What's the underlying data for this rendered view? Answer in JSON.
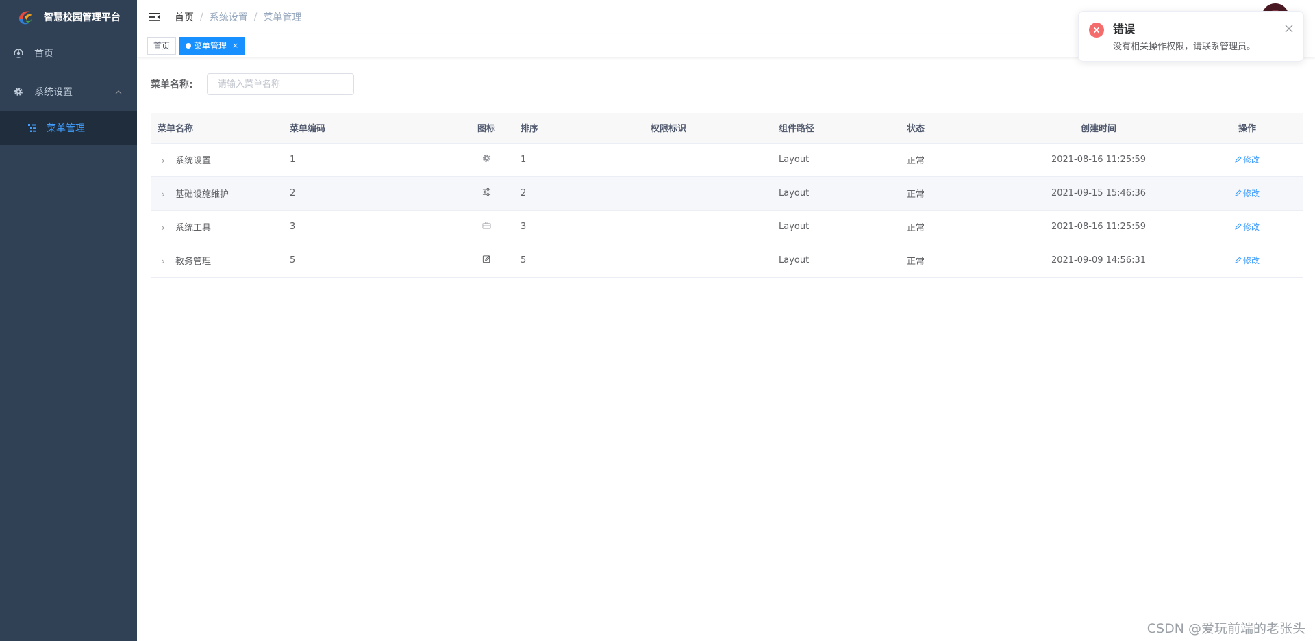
{
  "sidebar": {
    "logo_title": "智慧校园管理平台",
    "items": [
      {
        "label": "首页",
        "icon": "dashboard-icon"
      },
      {
        "label": "系统设置",
        "icon": "gear-icon"
      },
      {
        "label": "菜单管理",
        "icon": "tree-table-icon"
      }
    ]
  },
  "navbar": {
    "breadcrumb": [
      "首页",
      "系统设置",
      "菜单管理"
    ],
    "separator": "/"
  },
  "tags": [
    {
      "label": "首页",
      "active": false
    },
    {
      "label": "菜单管理",
      "active": true,
      "close": "×"
    }
  ],
  "search": {
    "label": "菜单名称:",
    "placeholder": "请输入菜单名称"
  },
  "table": {
    "headers": [
      "菜单名称",
      "菜单编码",
      "图标",
      "排序",
      "权限标识",
      "组件路径",
      "状态",
      "创建时间",
      "操作"
    ],
    "rows": [
      {
        "name": "系统设置",
        "code": "1",
        "icon": "gear-icon",
        "order": "1",
        "perm": "",
        "component": "Layout",
        "status": "正常",
        "created": "2021-08-16 11:25:59",
        "action": "修改"
      },
      {
        "name": "基础设施维护",
        "code": "2",
        "icon": "sliders-icon",
        "order": "2",
        "perm": "",
        "component": "Layout",
        "status": "正常",
        "created": "2021-09-15 15:46:36",
        "action": "修改"
      },
      {
        "name": "系统工具",
        "code": "3",
        "icon": "toolbox-icon",
        "order": "3",
        "perm": "",
        "component": "Layout",
        "status": "正常",
        "created": "2021-08-16 11:25:59",
        "action": "修改"
      },
      {
        "name": "教务管理",
        "code": "5",
        "icon": "edit-icon",
        "order": "5",
        "perm": "",
        "component": "Layout",
        "status": "正常",
        "created": "2021-09-09 14:56:31",
        "action": "修改"
      }
    ]
  },
  "notification": {
    "title": "错误",
    "message": "没有相关操作权限，请联系管理员。"
  },
  "watermark": "CSDN @爱玩前端的老张头",
  "colors": {
    "sidebar_bg": "#304156",
    "sidebar_active_bg": "#1f2d3d",
    "accent": "#1890ff",
    "link": "#409eff",
    "error": "#f56c6c"
  }
}
